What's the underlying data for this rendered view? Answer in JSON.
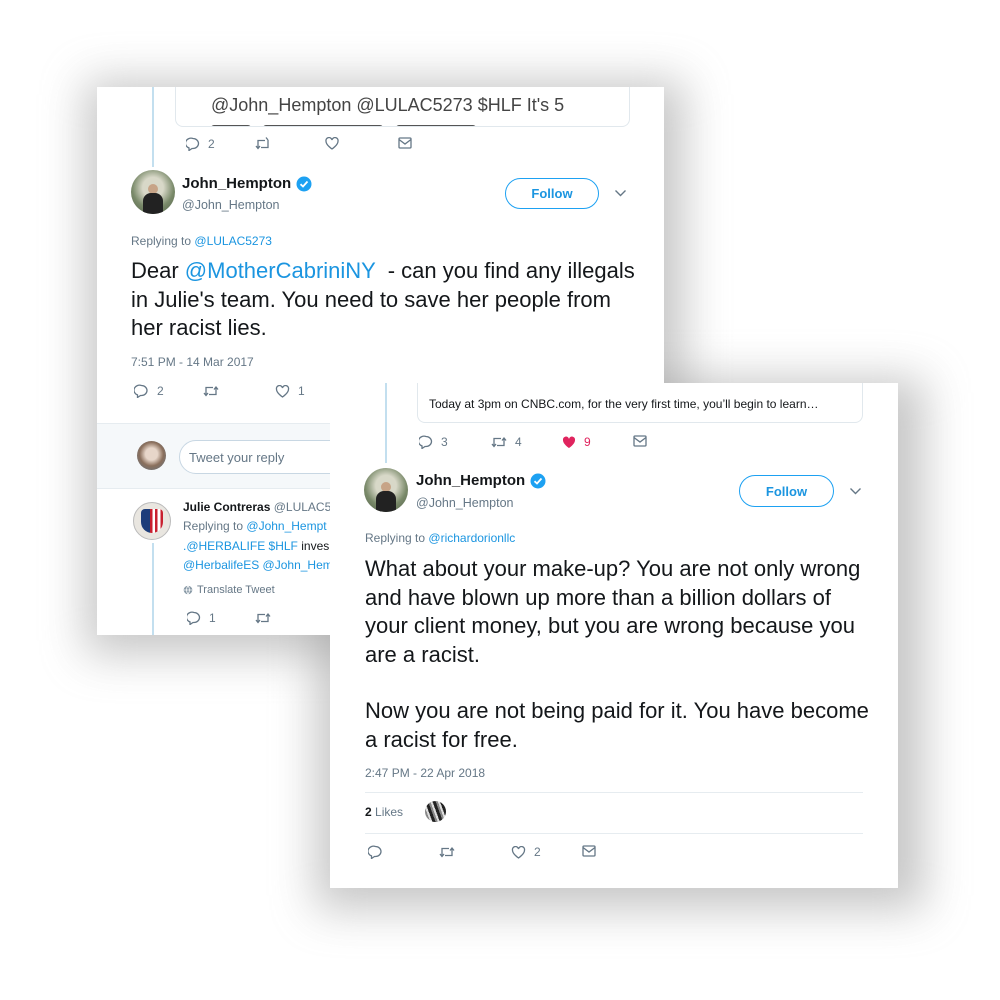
{
  "colors": {
    "link": "#1b95e0",
    "like_active": "#e0245e",
    "muted": "#657786",
    "verified": "#1da1f2"
  },
  "tweet1": {
    "quote_text": "@John_Hempton @LULAC5273 $HLF It's 5",
    "quote_actions": {
      "reply_count": "2"
    },
    "author_name": "John_Hempton",
    "author_handle": "@John_Hempton",
    "follow_label": "Follow",
    "replying_prefix": "Replying to",
    "replying_handle": "@LULAC5273",
    "body": {
      "prefix": "Dear ",
      "mention": "@MotherCabriniNY",
      "rest": "  - can you find any illegals in Julie's team. You need to save her people from her racist lies."
    },
    "timestamp": "7:51 PM - 14 Mar 2017",
    "actions": {
      "reply_count": "2",
      "like_count": "1"
    },
    "reply_placeholder": "Tweet your reply",
    "reply_tweet": {
      "author_name": "Julie Contreras",
      "author_handle": "@LULAC5",
      "replying_prefix": "Replying to",
      "replying_handle": "@John_Hempt",
      "line1_link": ".@HERBALIFE $HLF",
      "line1_rest": " inves",
      "line2": "@HerbalifeES @John_Hem",
      "translate_label": "Translate Tweet",
      "reply_count": "1"
    }
  },
  "tweet2": {
    "quote_text": "Today at 3pm on CNBC.com, for the very first time, you’ll begin to learn…",
    "quote_actions": {
      "reply_count": "3",
      "retweet_count": "4",
      "like_count": "9"
    },
    "author_name": "John_Hempton",
    "author_handle": "@John_Hempton",
    "follow_label": "Follow",
    "replying_prefix": "Replying to",
    "replying_handle": "@richardorionllc",
    "body_p1": "What about your make-up? You are not only wrong and have blown up more than a billion dollars of your client money, but you are wrong because you are a racist.",
    "body_p2": "Now you are not being paid for it. You have become a racist for free.",
    "timestamp": "2:47 PM - 22 Apr 2018",
    "likes_count": "2",
    "likes_label": "Likes",
    "actions": {
      "like_count": "2"
    }
  }
}
